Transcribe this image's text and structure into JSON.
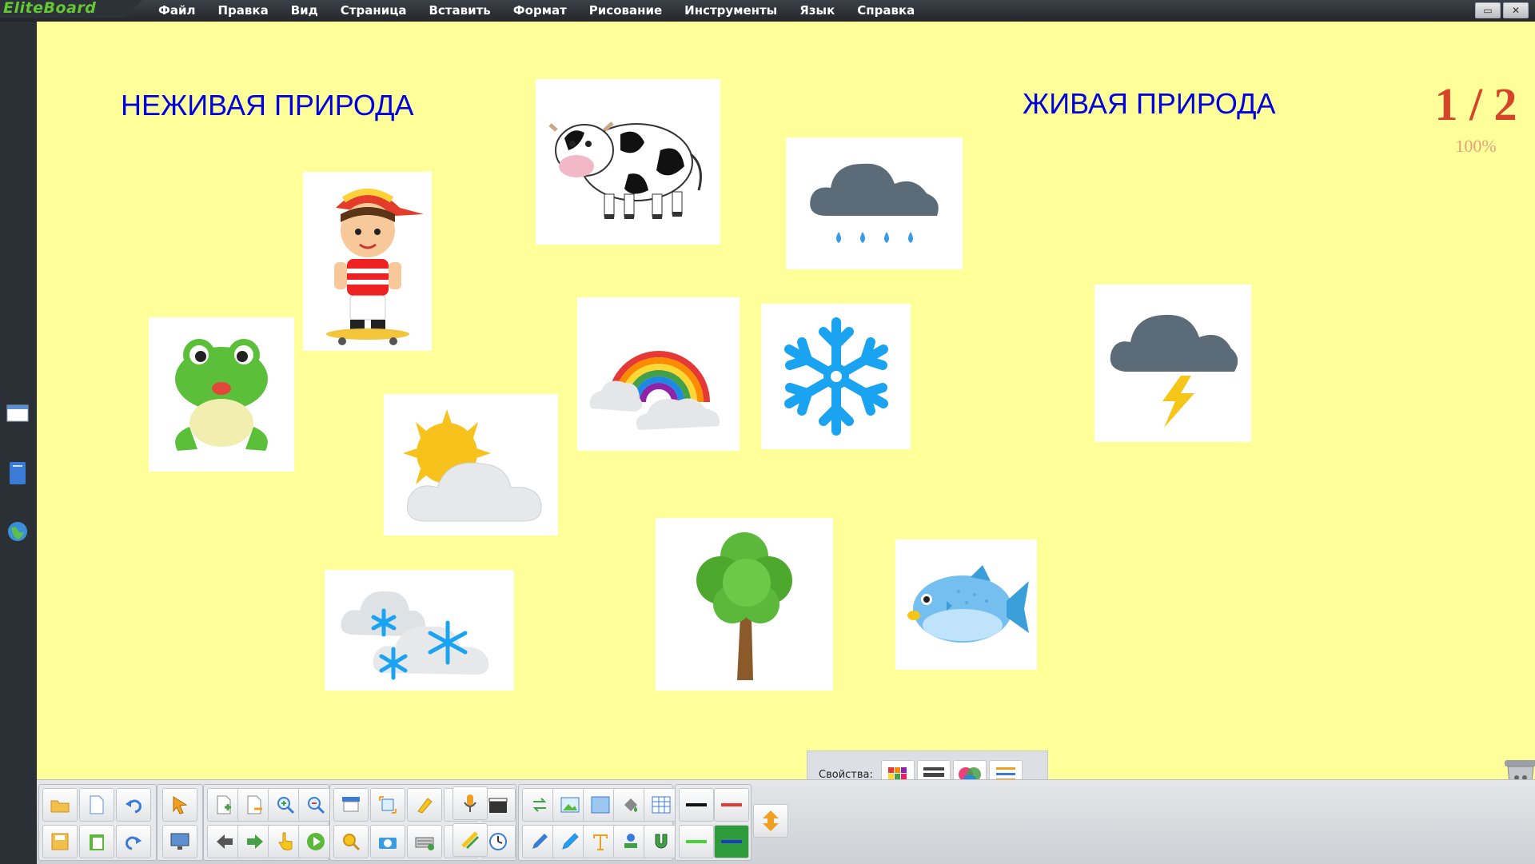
{
  "app": {
    "name": "EliteBoard"
  },
  "menu": [
    "Файл",
    "Правка",
    "Вид",
    "Страница",
    "Вставить",
    "Формат",
    "Рисование",
    "Инструменты",
    "Язык",
    "Справка"
  ],
  "window_controls": {
    "minimize": "▭",
    "close": "✕"
  },
  "canvas": {
    "heading_left": "НЕЖИВАЯ ПРИРОДА",
    "heading_right": "ЖИВАЯ ПРИРОДА",
    "page_counter": "1 / 2",
    "zoom": "100%",
    "background": "#ffff99"
  },
  "cards": [
    {
      "name": "boy-card",
      "icon": "boy-on-skateboard"
    },
    {
      "name": "cow-card",
      "icon": "cow"
    },
    {
      "name": "rain-cloud-card",
      "icon": "rain-cloud"
    },
    {
      "name": "frog-card",
      "icon": "frog"
    },
    {
      "name": "rainbow-card",
      "icon": "rainbow-with-clouds"
    },
    {
      "name": "snowflake-card",
      "icon": "snowflake"
    },
    {
      "name": "thunder-cloud-card",
      "icon": "thunderstorm-cloud"
    },
    {
      "name": "sun-cloud-card",
      "icon": "sun-behind-cloud"
    },
    {
      "name": "snow-clouds-card",
      "icon": "snow-clouds"
    },
    {
      "name": "tree-card",
      "icon": "tree"
    },
    {
      "name": "fish-card",
      "icon": "puffer-fish"
    }
  ],
  "properties_panel": {
    "label": "Свойства:"
  },
  "colors": {
    "accent_red": "#d6452a",
    "heading_blue": "#0000e0",
    "logo_green": "#64c832"
  }
}
